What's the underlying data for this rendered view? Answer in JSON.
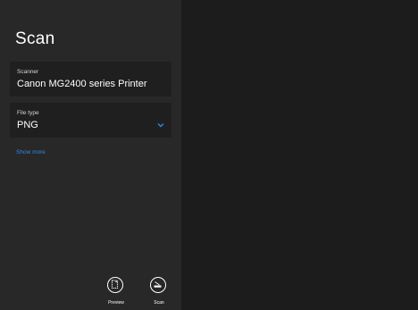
{
  "title": "Scan",
  "scanner": {
    "label": "Scanner",
    "value": "Canon MG2400 series Printer"
  },
  "file_type": {
    "label": "File type",
    "value": "PNG",
    "icon": "chevron-down-icon"
  },
  "show_more": "Show more",
  "actions": {
    "preview": {
      "label": "Preview",
      "icon": "preview-icon"
    },
    "scan": {
      "label": "Scan",
      "icon": "scan-icon"
    }
  },
  "colors": {
    "accent": "#2f87e6",
    "pane": "#282828",
    "background": "#1c1c1c"
  }
}
